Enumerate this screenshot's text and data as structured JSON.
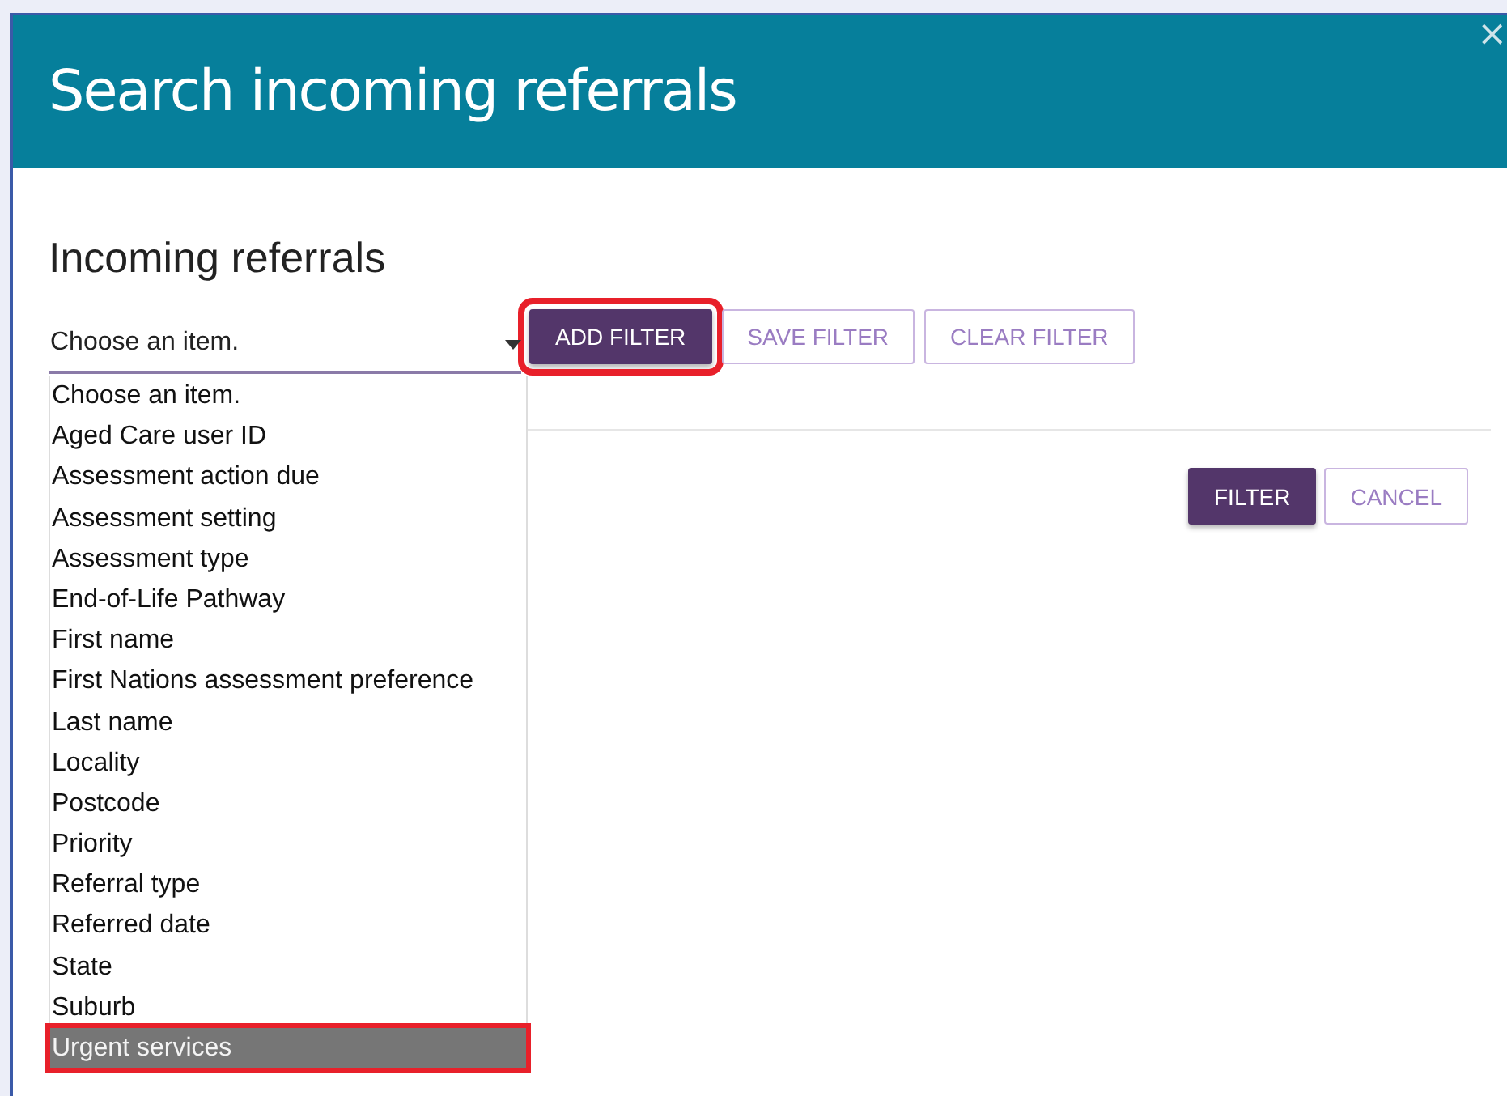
{
  "dialog": {
    "title": "Search incoming referrals",
    "close": "×"
  },
  "heading": "Incoming referrals",
  "select": {
    "value": "Choose an item.",
    "expanded": true,
    "options": [
      {
        "label": "Choose an item.",
        "focused": false,
        "annotated": false
      },
      {
        "label": "Aged Care user ID",
        "focused": false,
        "annotated": false
      },
      {
        "label": "Assessment action due",
        "focused": false,
        "annotated": false
      },
      {
        "label": "Assessment setting",
        "focused": false,
        "annotated": false
      },
      {
        "label": "Assessment type",
        "focused": false,
        "annotated": false
      },
      {
        "label": "End-of-Life Pathway",
        "focused": false,
        "annotated": false
      },
      {
        "label": "First name",
        "focused": false,
        "annotated": false
      },
      {
        "label": "First Nations assessment preference",
        "focused": false,
        "annotated": false
      },
      {
        "label": "Last name",
        "focused": false,
        "annotated": false
      },
      {
        "label": "Locality",
        "focused": false,
        "annotated": false
      },
      {
        "label": "Postcode",
        "focused": false,
        "annotated": false
      },
      {
        "label": "Priority",
        "focused": false,
        "annotated": false
      },
      {
        "label": "Referral type",
        "focused": false,
        "annotated": false
      },
      {
        "label": "Referred date",
        "focused": false,
        "annotated": false
      },
      {
        "label": "State",
        "focused": false,
        "annotated": false
      },
      {
        "label": "Suburb",
        "focused": false,
        "annotated": false
      },
      {
        "label": "Urgent services",
        "focused": true,
        "annotated": true
      }
    ]
  },
  "filter_buttons": [
    {
      "label": "ADD FILTER",
      "kind": "primary",
      "annotated": true
    },
    {
      "label": "SAVE FILTER",
      "kind": "outline",
      "annotated": false
    },
    {
      "label": "CLEAR FILTER",
      "kind": "outline",
      "annotated": false
    }
  ],
  "action_buttons": [
    {
      "label": "FILTER",
      "kind": "primary"
    },
    {
      "label": "CANCEL",
      "kind": "outline"
    }
  ]
}
